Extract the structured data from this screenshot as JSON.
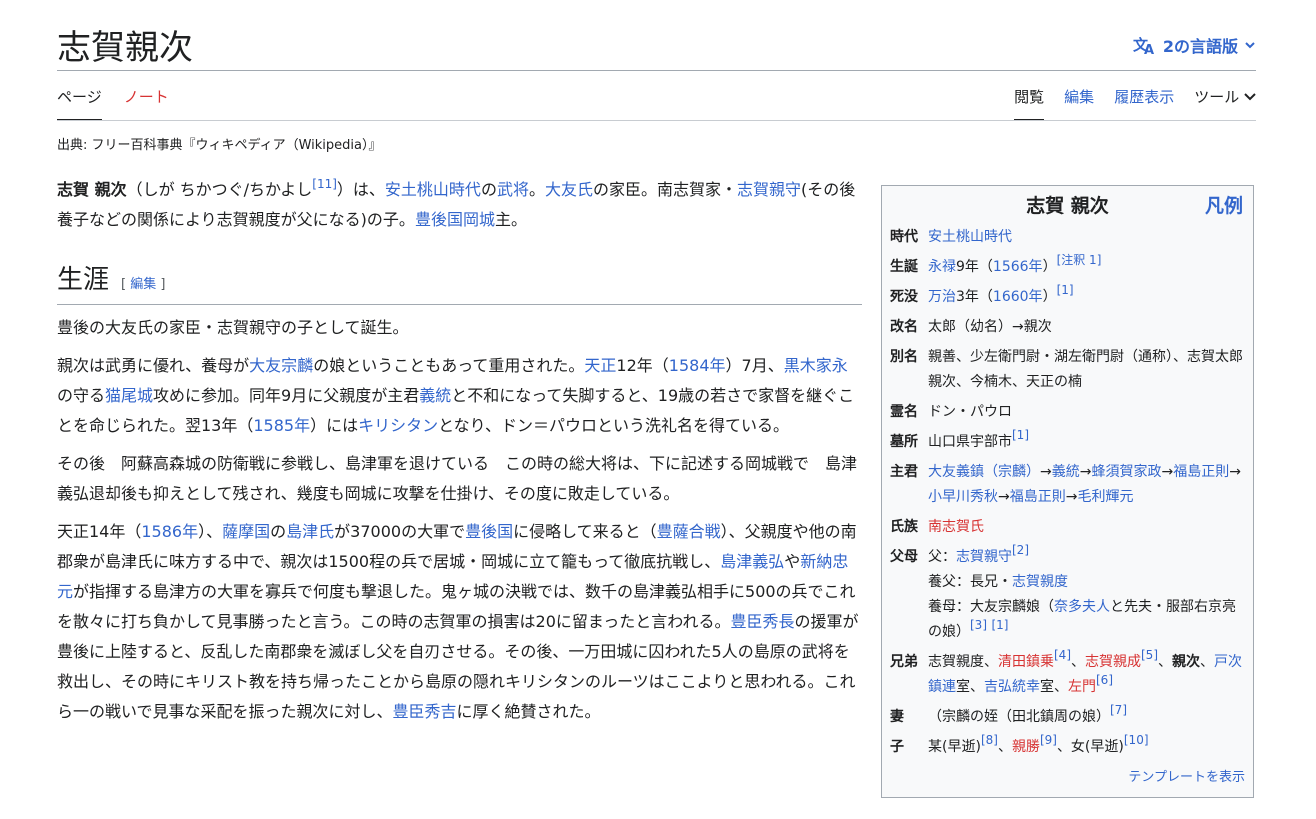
{
  "title": "志賀親次",
  "lang_button": "2の言語版",
  "tabs": {
    "page": "ページ",
    "talk": "ノート",
    "read": "閲覧",
    "edit": "編集",
    "history": "履歴表示",
    "tools": "ツール"
  },
  "source": "出典: フリー百科事典『ウィキペディア（Wikipedia）』",
  "lead": {
    "bold": "志賀 親次",
    "p1": "（しが ちかつぐ/ちかよし",
    "s1": "[11]",
    "p2": "）は、",
    "l1": "安土桃山時代",
    "p3": "の",
    "l2": "武将",
    "p4": "。",
    "l3": "大友氏",
    "p5": "の家臣。南志賀家・",
    "l4": "志賀親守",
    "p6": "(その後養子などの関係により志賀親度が父になる)の子。",
    "l5": "豊後国",
    "l6": "岡城",
    "p7": "主。"
  },
  "section": {
    "heading": "生涯",
    "edit_open": "[ ",
    "edit_label": "編集",
    "edit_close": " ]"
  },
  "para1": "豊後の大友氏の家臣・志賀親守の子として誕生。",
  "para2": {
    "t1": "親次は武勇に優れ、養母が",
    "l1": "大友宗麟",
    "t2": "の娘ということもあって重用された。",
    "l2": "天正",
    "t3": "12年（",
    "l3": "1584年",
    "t4": "）7月、",
    "l4": "黒木家永",
    "t5": "の守る",
    "l5": "猫尾城",
    "t6": "攻めに参加。同年9月に父親度が主君",
    "l6": "義統",
    "t7": "と不和になって失脚すると、19歳の若さで家督を継ぐことを命じられた。翌13年（",
    "l7": "1585年",
    "t8": "）には",
    "l8": "キリシタン",
    "t9": "となり、ドン＝パウロという洗礼名を得ている。"
  },
  "para3": "その後　阿蘇高森城の防衛戦に参戦し、島津軍を退けている　この時の総大将は、下に記述する岡城戦で　島津義弘退却後も抑えとして残され、幾度も岡城に攻撃を仕掛け、その度に敗走している。",
  "para4": {
    "t1": "天正14年（",
    "l1": "1586年",
    "t2": "）、",
    "l2": "薩摩国",
    "t3": "の",
    "l3": "島津氏",
    "t4": "が37000の大軍で",
    "l4": "豊後国",
    "t5": "に侵略して来ると（",
    "l5": "豊薩合戦",
    "t6": "）、父親度や他の南郡衆が島津氏に味方する中で、親次は1500程の兵で居城・岡城に立て籠もって徹底抗戦し、",
    "l6": "島津義弘",
    "t7": "や",
    "l7": "新納忠元",
    "t8": "が指揮する島津方の大軍を寡兵で何度も撃退した。鬼ヶ城の決戦では、数千の島津義弘相手に500の兵でこれを散々に打ち負かして見事勝ったと言う。この時の志賀軍の損害は20に留まったと言われる。",
    "l8": "豊臣秀長",
    "t9": "の援軍が豊後に上陸すると、反乱した南郡衆を滅ぼし父を自刃させる。その後、一万田城に囚われた5人の島原の武将を救出し、その時にキリスト教を持ち帰ったことから島原の隠れキリシタンのルーツはここよりと思われる。これら一の戦いで見事な采配を振った親次に対し、",
    "l9": "豊臣秀吉",
    "t10": "に厚く絶賛された。"
  },
  "infobox": {
    "title": "志賀 親次",
    "legend": "凡例",
    "era_k": "時代",
    "era_v": "安土桃山時代",
    "birth_k": "生誕",
    "birth_l1": "永禄",
    "birth_t1": "9年（",
    "birth_l2": "1566年",
    "birth_t2": "）",
    "birth_s": "[注釈 1]",
    "death_k": "死没",
    "death_l1": "万治",
    "death_t1": "3年（",
    "death_l2": "1660年",
    "death_t2": "）",
    "death_s": "[1]",
    "rename_k": "改名",
    "rename_v": "太郎（幼名）→親次",
    "alias_k": "別名",
    "alias_v": "親善、少左衛門尉・湖左衛門尉（通称）、志賀太郎親次、今楠木、天正の楠",
    "spirit_k": "霊名",
    "spirit_v": "ドン・パウロ",
    "grave_k": "墓所",
    "grave_v": "山口県宇部市",
    "grave_s": "[1]",
    "lord_k": "主君",
    "lord_l1": "大友義鎮（宗麟）",
    "lord_a1": "→",
    "lord_l2": "義統",
    "lord_a2": "→",
    "lord_l3": "蜂須賀家政",
    "lord_a3": "→",
    "lord_l4": "福島正則",
    "lord_a4": "→",
    "lord_l5": "小早川秀秋",
    "lord_a5": "→",
    "lord_l6": "福島正則",
    "lord_a6": "→",
    "lord_l7": "毛利輝元",
    "clan_k": "氏族",
    "clan_v": "南志賀氏",
    "parents_k": "父母",
    "father_t": "父：",
    "father_l": "志賀親守",
    "father_s": "[2]",
    "adopt_t": "養父：長兄・",
    "adopt_l": "志賀親度",
    "mother_t1": "養母：大友宗麟娘（",
    "mother_l": "奈多夫人",
    "mother_t2": "と先夫・服部右京亮の娘）",
    "mother_s1": "[3]",
    "mother_s2": "[1]",
    "sib_k": "兄弟",
    "sib_t1": "志賀親度、",
    "sib_r1": "清田鎮乗",
    "sib_s1": "[4]",
    "sib_t2": "、",
    "sib_r2": "志賀親成",
    "sib_s2": "[5]",
    "sib_t3": "、",
    "sib_b": "親次",
    "sib_t4": "、",
    "sib_l1": "戸次鎮連",
    "sib_t5": "室、",
    "sib_l2": "吉弘統幸",
    "sib_t6": "室、",
    "sib_r3": "左門",
    "sib_s3": "[6]",
    "wife_k": "妻",
    "wife_v": "（宗麟の姪（田北鎮周の娘）",
    "wife_s": "[7]",
    "child_k": "子",
    "child_t1": "某(早逝)",
    "child_s1": "[8]",
    "child_t2": "、",
    "child_r": "親勝",
    "child_s2": "[9]",
    "child_t3": "、女(早逝)",
    "child_s3": "[10]",
    "footer": "テンプレートを表示"
  },
  "colors": {
    "link": "#3366cc",
    "redlink": "#d73333",
    "text": "#202122",
    "border": "#a2a9b1"
  }
}
